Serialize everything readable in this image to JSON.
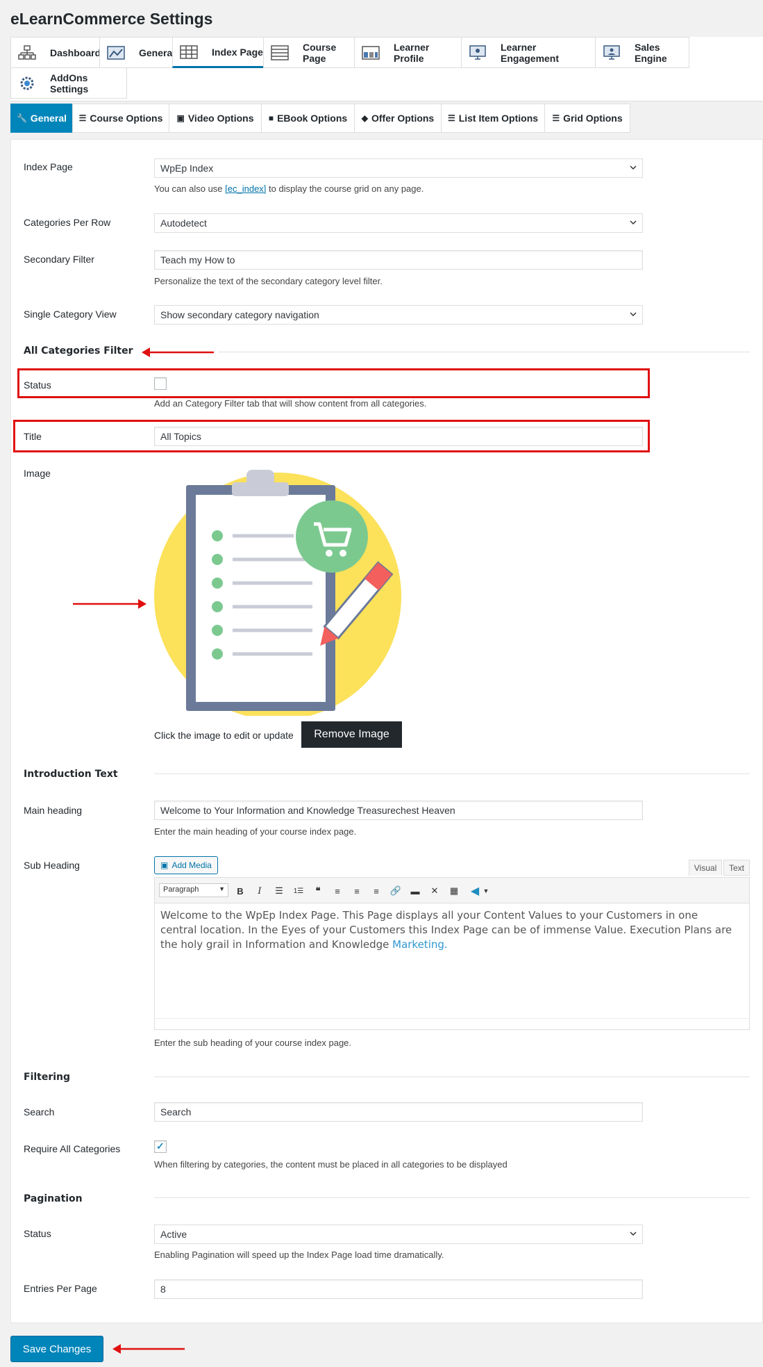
{
  "page": {
    "title": "eLearnCommerce Settings"
  },
  "top_tabs": [
    {
      "label": "Dashboard",
      "icon": "sitemap-icon"
    },
    {
      "label": "General",
      "icon": "dashboard-icon"
    },
    {
      "label": "Index Page",
      "icon": "grid-icon",
      "active": true
    },
    {
      "label": "Course Page",
      "icon": "list-icon"
    },
    {
      "label": "Learner Profile",
      "icon": "layout-icon"
    },
    {
      "label": "Learner Engagement",
      "icon": "monitor-icon"
    },
    {
      "label": "Sales Engine",
      "icon": "monitor-user-icon"
    },
    {
      "label": "AddOns Settings",
      "icon": "gear-icon"
    }
  ],
  "sub_tabs": [
    {
      "label": "General",
      "icon": "wrench-icon",
      "active": true
    },
    {
      "label": "Course Options",
      "icon": "sliders-icon"
    },
    {
      "label": "Video Options",
      "icon": "video-icon"
    },
    {
      "label": "EBook Options",
      "icon": "book-icon"
    },
    {
      "label": "Offer Options",
      "icon": "tag-icon"
    },
    {
      "label": "List Item Options",
      "icon": "list-icon"
    },
    {
      "label": "Grid Options",
      "icon": "list-icon"
    }
  ],
  "form": {
    "index_page": {
      "label": "Index Page",
      "value": "WpEp Index",
      "help_pre": "You can also use ",
      "help_link": "[ec_index]",
      "help_post": " to display the course grid on any page."
    },
    "categories_per_row": {
      "label": "Categories Per Row",
      "value": "Autodetect"
    },
    "secondary_filter": {
      "label": "Secondary Filter",
      "value": "Teach my How to",
      "help": "Personalize the text of the secondary category level filter."
    },
    "single_category_view": {
      "label": "Single Category View",
      "value": "Show secondary category navigation"
    },
    "all_categories_filter": {
      "heading": "All Categories Filter",
      "status_label": "Status",
      "status_checked": false,
      "status_help": "Add an Category Filter tab that will show content from all categories.",
      "title_label": "Title",
      "title_value": "All Topics",
      "image_label": "Image",
      "image_help": "Click the image to edit or update",
      "remove_image": "Remove Image"
    },
    "introduction_text": {
      "heading": "Introduction Text",
      "main_heading_label": "Main heading",
      "main_heading_value": "Welcome to Your Information and Knowledge Treasurechest Heaven",
      "main_heading_help": "Enter the main heading of your course index page.",
      "sub_heading_label": "Sub Heading",
      "add_media": "Add Media",
      "tab_visual": "Visual",
      "tab_text": "Text",
      "format_select": "Paragraph",
      "content_text": "Welcome to the WpEp Index Page. This Page displays all your Content Values to your Customers in one central location. In the Eyes of your Customers this Index Page can be of immense Value. Execution Plans are the holy grail in Information and Knowledge ",
      "content_link": "Marketing.",
      "sub_heading_help": "Enter the sub heading of your course index page."
    },
    "filtering": {
      "heading": "Filtering",
      "search_label": "Search",
      "search_value": "Search",
      "require_all_label": "Require All Categories",
      "require_all_checked": true,
      "require_all_help": "When filtering by categories, the content must be placed in all categories to be displayed"
    },
    "pagination": {
      "heading": "Pagination",
      "status_label": "Status",
      "status_value": "Active",
      "status_help": "Enabling Pagination will speed up the Index Page load time dramatically.",
      "entries_label": "Entries Per Page",
      "entries_value": "8"
    }
  },
  "save_button": "Save Changes",
  "colors": {
    "accent": "#0085ba",
    "annotation": "#e01010",
    "image_circle": "#fce15a",
    "cart_green": "#7cc990"
  }
}
